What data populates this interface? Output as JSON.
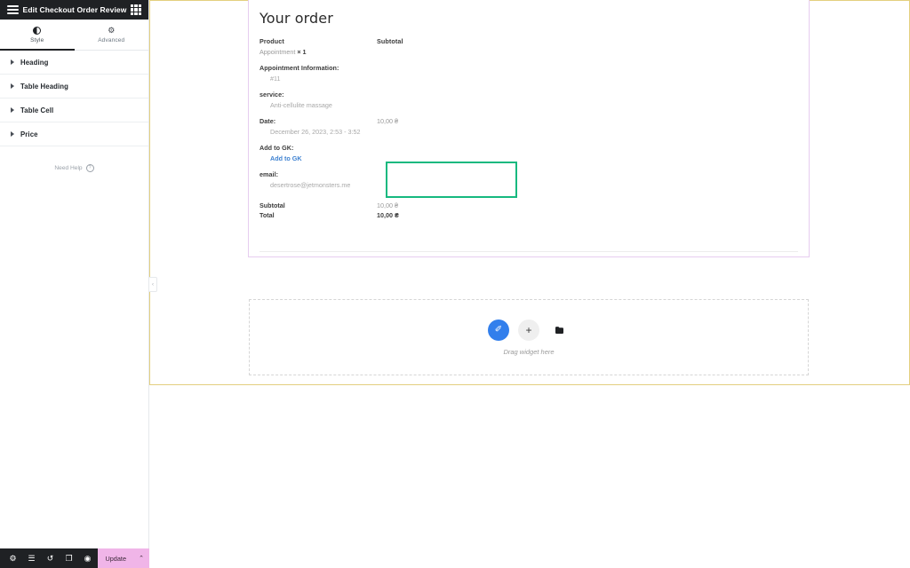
{
  "panel": {
    "header": {
      "title": "Edit Checkout Order Review",
      "menu_icon": "hamburger-icon",
      "apps_icon": "grid-apps-icon"
    },
    "tabs": [
      {
        "label": "Style",
        "icon": "contrast-icon",
        "active": true
      },
      {
        "label": "Advanced",
        "icon": "gear-icon",
        "active": false
      }
    ],
    "sections": [
      {
        "label": "Heading"
      },
      {
        "label": "Table Heading"
      },
      {
        "label": "Table Cell"
      },
      {
        "label": "Price"
      }
    ],
    "need_help": {
      "label": "Need Help",
      "icon": "question-circle-icon",
      "glyph": "?"
    },
    "collapse_handle": {
      "icon": "chevron-left-icon",
      "glyph": "‹"
    }
  },
  "bottom_bar": {
    "icons": [
      {
        "name": "settings-icon",
        "glyph": "⚙"
      },
      {
        "name": "navigator-layers-icon",
        "glyph": "☰"
      },
      {
        "name": "history-icon",
        "glyph": "↺"
      },
      {
        "name": "responsive-mode-icon",
        "glyph": "❐"
      },
      {
        "name": "preview-changes-icon",
        "glyph": "◉"
      }
    ],
    "update_label": "Update",
    "update_caret_glyph": "⌃",
    "update_color": "#f0b5e8"
  },
  "canvas": {
    "section_outline_color": "#e3cf7f",
    "widget_outline_color": "#e7cdf0",
    "selection_color": "#16b97f",
    "order": {
      "title": "Your order",
      "headers": {
        "product": "Product",
        "subtotal": "Subtotal"
      },
      "product": {
        "name": "Appointment",
        "quantity": "× 1"
      },
      "meta": [
        {
          "key": "Appointment Information:",
          "value": "#11",
          "amount": "",
          "link": false
        },
        {
          "key": "service:",
          "value": "Anti-cellulite massage",
          "amount": "",
          "link": false
        },
        {
          "key": "Date:",
          "value": "December 26, 2023, 2:53 - 3:52",
          "amount": "10,00 ₴",
          "link": false
        },
        {
          "key": "Add to GK:",
          "value": "Add to GK",
          "amount": "",
          "link": true
        },
        {
          "key": "email:",
          "value": "desertrose@jetmonsters.me",
          "amount": "",
          "link": false
        }
      ],
      "totals": [
        {
          "label": "Subtotal",
          "amount": "10,00 ₴",
          "bold": false
        },
        {
          "label": "Total",
          "amount": "10,00 ₴",
          "bold": true
        }
      ]
    },
    "drop_zone": {
      "label": "Drag widget here",
      "buttons": [
        {
          "name": "edit-magic-wand-button",
          "glyph": "✐",
          "style": "primary"
        },
        {
          "name": "add-widget-button",
          "glyph": "+",
          "style": "secondary"
        },
        {
          "name": "add-template-folder-button",
          "glyph": "☰",
          "style": "folder"
        }
      ]
    }
  }
}
